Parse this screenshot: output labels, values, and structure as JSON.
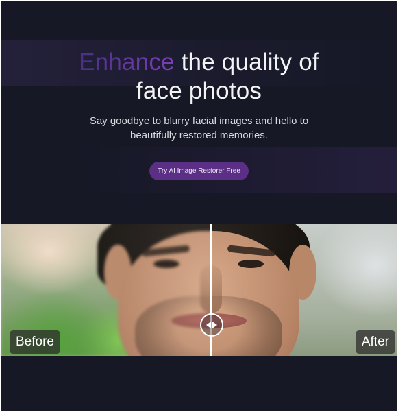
{
  "hero": {
    "headline_accent": "Enhance",
    "headline_rest": " the quality of",
    "headline_line2": "face photos",
    "subtitle": "Say goodbye to blurry facial images and hello to beautifully restored memories.",
    "cta_label": "Try AI Image Restorer Free"
  },
  "comparison": {
    "before_label": "Before",
    "after_label": "After",
    "handle_icon": "left-right-arrows-icon"
  },
  "colors": {
    "background": "#161826",
    "accent": "#5b2f86",
    "text": "#f3f3f6"
  }
}
